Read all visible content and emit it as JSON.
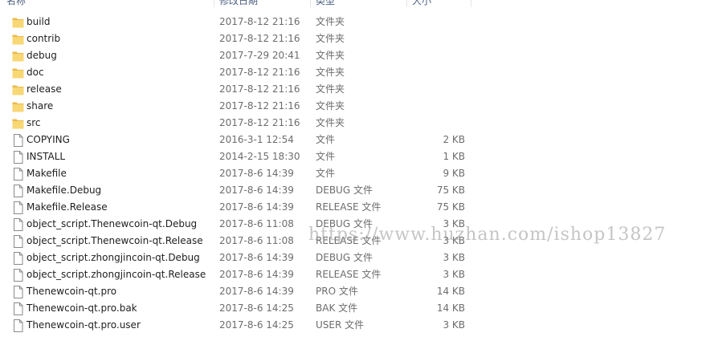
{
  "header": {
    "col_name": "名称",
    "col_date": "修改日期",
    "col_type": "类型",
    "col_size": "大小"
  },
  "files": [
    {
      "name": "build",
      "date": "2017-8-12 21:16",
      "type": "文件夹",
      "size": "",
      "icon": "folder-icon"
    },
    {
      "name": "contrib",
      "date": "2017-8-12 21:16",
      "type": "文件夹",
      "size": "",
      "icon": "folder-icon"
    },
    {
      "name": "debug",
      "date": "2017-7-29 20:41",
      "type": "文件夹",
      "size": "",
      "icon": "folder-icon"
    },
    {
      "name": "doc",
      "date": "2017-8-12 21:16",
      "type": "文件夹",
      "size": "",
      "icon": "folder-icon"
    },
    {
      "name": "release",
      "date": "2017-8-12 21:16",
      "type": "文件夹",
      "size": "",
      "icon": "folder-icon"
    },
    {
      "name": "share",
      "date": "2017-8-12 21:16",
      "type": "文件夹",
      "size": "",
      "icon": "folder-icon"
    },
    {
      "name": "src",
      "date": "2017-8-12 21:16",
      "type": "文件夹",
      "size": "",
      "icon": "folder-icon"
    },
    {
      "name": "COPYING",
      "date": "2016-3-1 12:54",
      "type": "文件",
      "size": "2 KB",
      "icon": "file-icon"
    },
    {
      "name": "INSTALL",
      "date": "2014-2-15 18:30",
      "type": "文件",
      "size": "1 KB",
      "icon": "file-icon"
    },
    {
      "name": "Makefile",
      "date": "2017-8-6 14:39",
      "type": "文件",
      "size": "9 KB",
      "icon": "file-icon"
    },
    {
      "name": "Makefile.Debug",
      "date": "2017-8-6 14:39",
      "type": "DEBUG 文件",
      "size": "75 KB",
      "icon": "file-icon"
    },
    {
      "name": "Makefile.Release",
      "date": "2017-8-6 14:39",
      "type": "RELEASE 文件",
      "size": "75 KB",
      "icon": "file-icon"
    },
    {
      "name": "object_script.Thenewcoin-qt.Debug",
      "date": "2017-8-6 11:08",
      "type": "DEBUG 文件",
      "size": "3 KB",
      "icon": "file-icon"
    },
    {
      "name": "object_script.Thenewcoin-qt.Release",
      "date": "2017-8-6 11:08",
      "type": "RELEASE 文件",
      "size": "3 KB",
      "icon": "file-icon"
    },
    {
      "name": "object_script.zhongjincoin-qt.Debug",
      "date": "2017-8-6 14:39",
      "type": "DEBUG 文件",
      "size": "3 KB",
      "icon": "file-icon"
    },
    {
      "name": "object_script.zhongjincoin-qt.Release",
      "date": "2017-8-6 14:39",
      "type": "RELEASE 文件",
      "size": "3 KB",
      "icon": "file-icon"
    },
    {
      "name": "Thenewcoin-qt.pro",
      "date": "2017-8-6 14:39",
      "type": "PRO 文件",
      "size": "14 KB",
      "icon": "file-icon"
    },
    {
      "name": "Thenewcoin-qt.pro.bak",
      "date": "2017-8-6 14:25",
      "type": "BAK 文件",
      "size": "14 KB",
      "icon": "file-icon"
    },
    {
      "name": "Thenewcoin-qt.pro.user",
      "date": "2017-8-6 14:25",
      "type": "USER 文件",
      "size": "3 KB",
      "icon": "file-icon"
    }
  ],
  "watermark": "https://www.huzhan.com/ishop13827",
  "colors": {
    "folder": "#f8d775",
    "folder_dark": "#e9b949",
    "text": "#1e1e1e",
    "meta_text": "#6d6d6d",
    "header_text": "#4d6082"
  }
}
